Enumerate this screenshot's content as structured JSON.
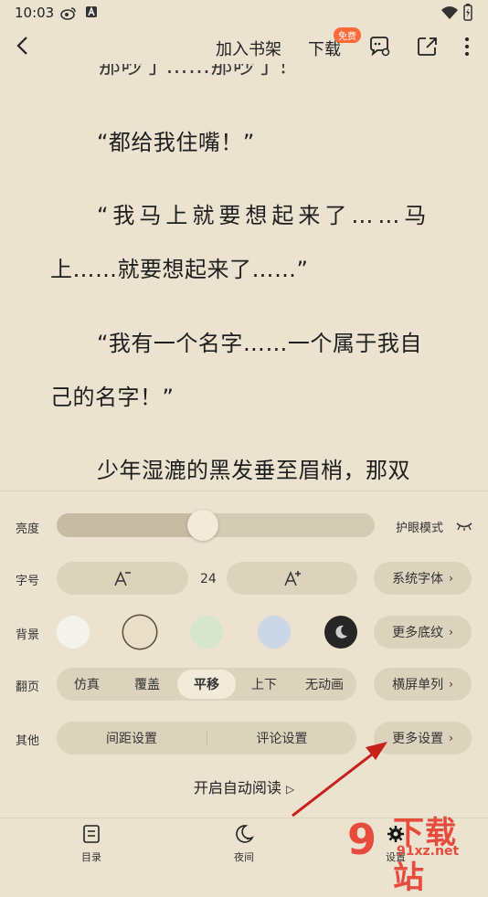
{
  "status": {
    "time": "10:03"
  },
  "topbar": {
    "add_shelf": "加入书架",
    "download": "下载",
    "free_badge": "免费"
  },
  "reading": {
    "paragraphs": [
      "那吵了……那吵了！",
      "“都给我住嘴！”",
      "“我马上就要想起来了……马",
      "上……就要想起来了……”",
      "“我有一个名字……一个属于我自",
      "己的名字！”",
      "少年湿漉的黑发垂至眉梢，那双"
    ]
  },
  "settings": {
    "brightness_label": "亮度",
    "brightness_level": 0.45,
    "eye_mode": "护眼模式",
    "font_size_label": "字号",
    "font_size": "24",
    "system_font": "系统字体",
    "background_label": "背景",
    "background_colors": [
      "#f5f3ee",
      "#e9dfc9",
      "#d6e5cd",
      "#c9d7e6",
      "#262626"
    ],
    "more_backgrounds": "更多底纹",
    "page_turn_label": "翻页",
    "page_turn_options": [
      "仿真",
      "覆盖",
      "平移",
      "上下",
      "无动画"
    ],
    "page_turn_selected": "平移",
    "landscape": "横屏单列",
    "other_label": "其他",
    "spacing": "间距设置",
    "comments": "评论设置",
    "more_settings": "更多设置",
    "auto_read": "开启自动阅读"
  },
  "bottomnav": {
    "toc": "目录",
    "night": "夜间",
    "settings": "设置"
  },
  "watermark": {
    "logo": "9",
    "title": "下载站",
    "url": "91xz.net"
  },
  "colors": {
    "accent": "#e74b3c",
    "background": "#ebe3cf",
    "pill": "#dcd3bd"
  }
}
